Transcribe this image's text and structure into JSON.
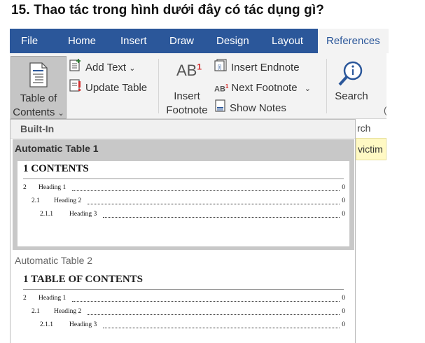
{
  "question": "15. Thao tác trong hình dưới đây có tác dụng gì?",
  "tabs": [
    "File",
    "Home",
    "Insert",
    "Draw",
    "Design",
    "Layout",
    "References"
  ],
  "ribbon": {
    "toc_line1": "Table of",
    "toc_line2": "Contents",
    "toc_caret": "⌄",
    "add_text": "Add Text",
    "add_text_caret": "⌄",
    "update_table": "Update Table",
    "insert_label_1": "Insert",
    "insert_label_2": "Footnote",
    "ab_glyph": "AB",
    "ab_sup": "1",
    "insert_endnote": "Insert Endnote",
    "next_footnote": "Next Footnote",
    "next_footnote_caret": "⌄",
    "show_notes": "Show Notes",
    "search": "Search",
    "search_cut": "rch",
    "victim": "victim",
    "edge_mark": "("
  },
  "dropdown": {
    "section": "Built-In",
    "item1": {
      "title": "Automatic Table 1",
      "heading": "1   CONTENTS",
      "entries": [
        {
          "num": "2",
          "text": "Heading 1",
          "page": "0"
        },
        {
          "num": "2.1",
          "text": "Heading 2",
          "page": "0"
        },
        {
          "num": "2.1.1",
          "text": "Heading 3",
          "page": "0"
        }
      ]
    },
    "item2": {
      "title": "Automatic Table 2",
      "heading": "1   TABLE OF CONTENTS",
      "entries": [
        {
          "num": "2",
          "text": "Heading 1",
          "page": "0"
        },
        {
          "num": "2.1",
          "text": "Heading 2",
          "page": "0"
        },
        {
          "num": "2.1.1",
          "text": "Heading 3",
          "page": "0"
        }
      ]
    }
  },
  "colors": {
    "tab_bar": "#2b579a",
    "ribbon_bg": "#f3f3f3",
    "selected_button": "#c5c5c5",
    "gallery_hover": "#c8c8c8",
    "tooltip": "#fff9c4",
    "search_icon": "#2b579a"
  }
}
